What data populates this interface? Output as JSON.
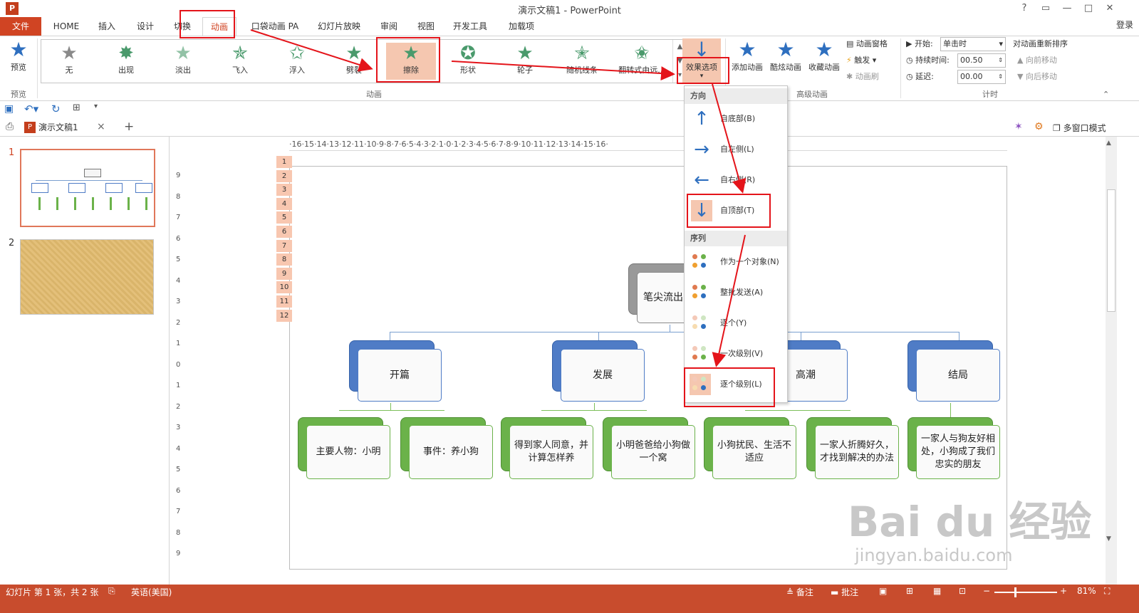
{
  "window": {
    "title": "演示文稿1 - PowerPoint",
    "app_icon": "P",
    "help": "?",
    "restore_ribbon": "▭",
    "minimize": "—",
    "maximize": "□",
    "close": "✕"
  },
  "menu": {
    "file": "文件",
    "tabs": [
      "HOME",
      "插入",
      "设计",
      "切换",
      "动画",
      "口袋动画 PA",
      "幻灯片放映",
      "审阅",
      "视图",
      "开发工具",
      "加载项"
    ],
    "login": "登录"
  },
  "ribbon": {
    "preview": {
      "label": "预览",
      "group": "预览"
    },
    "animation_group": "动画",
    "gallery": [
      {
        "label": "无",
        "type": "gray"
      },
      {
        "label": "出现"
      },
      {
        "label": "淡出"
      },
      {
        "label": "飞入"
      },
      {
        "label": "浮入"
      },
      {
        "label": "劈裂"
      },
      {
        "label": "擦除",
        "selected": true
      },
      {
        "label": "形状"
      },
      {
        "label": "轮子"
      },
      {
        "label": "随机线条"
      },
      {
        "label": "翻转式由远..."
      }
    ],
    "effect_options": "效果选项",
    "add_animation": "添加动画",
    "cool_animation": "酷炫动画",
    "collect_animation": "收藏动画",
    "anim_pane": "动画窗格",
    "trigger": "触发",
    "anim_painter": "动画刷",
    "advanced_group": "高级动画",
    "start_label": "开始:",
    "start_value": "单击时",
    "duration_label": "持续时间:",
    "duration_value": "00.50",
    "delay_label": "延迟:",
    "delay_value": "00.00",
    "timing_group": "计时",
    "reorder": "对动画重新排序",
    "move_earlier": "向前移动",
    "move_later": "向后移动"
  },
  "doc_tab": {
    "name": "演示文稿1",
    "close": "×",
    "add": "+"
  },
  "multiwindow": "多窗口模式",
  "slides": [
    {
      "num": "1"
    },
    {
      "num": "2"
    }
  ],
  "hruler_text": "·16·15·14·13·12·11·10·9·8·7·6·5·4·3·2·1·0·1·2·3·4·5·6·7·8·9·10·11·12·13·14·15·16·",
  "vruler": [
    "9",
    "8",
    "7",
    "6",
    "5",
    "4",
    "3",
    "2",
    "1",
    "0",
    "1",
    "2",
    "3",
    "4",
    "5",
    "6",
    "7",
    "8",
    "9"
  ],
  "anim_numbers": [
    "1",
    "2",
    "3",
    "4",
    "5",
    "6",
    "7",
    "8",
    "9",
    "10",
    "11",
    "12"
  ],
  "diagram": {
    "root": "笔尖流出",
    "level1": [
      "开篇",
      "发展",
      "高潮",
      "结局"
    ],
    "level2": [
      "主要人物：小明",
      "事件：养小狗",
      "得到家人同意，并计算怎样养",
      "小明爸爸给小狗做一个窝",
      "小狗扰民、生活不适应",
      "一家人折腾好久，才找到解决的办法",
      "一家人与狗友好相处，小狗成了我们忠实的朋友"
    ]
  },
  "dropdown": {
    "direction_head": "方向",
    "directions": [
      "自底部(B)",
      "自左侧(L)",
      "自右侧(R)",
      "自顶部(T)"
    ],
    "sequence_head": "序列",
    "sequences": [
      "作为一个对象(N)",
      "整批发送(A)",
      "逐个(Y)",
      "一次级别(V)",
      "逐个级别(L)"
    ]
  },
  "status": {
    "slide_info": "幻灯片 第 1 张，共 2 张",
    "language": "英语(美国)",
    "notes": "备注",
    "comments": "批注",
    "zoom": "81%"
  },
  "watermark": {
    "main": "Bai du 经验",
    "sub": "jingyan.baidu.com"
  },
  "colors": {
    "accent": "#d04423",
    "status_bar": "#c84c2d",
    "highlight": "#e4141a"
  }
}
